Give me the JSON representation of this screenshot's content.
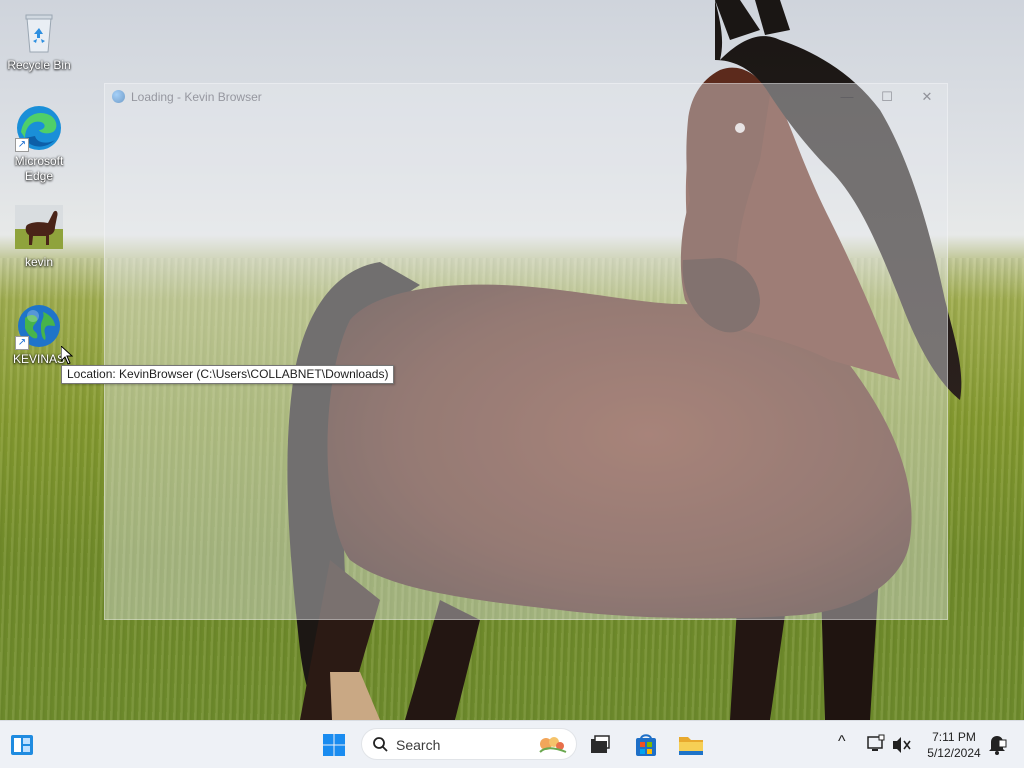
{
  "desktop": {
    "icons": [
      {
        "label": "Recycle Bin"
      },
      {
        "label": "Microsoft Edge"
      },
      {
        "label": "kevin"
      },
      {
        "label": "KEVINAS"
      }
    ]
  },
  "window": {
    "title": "Loading - Kevin Browser",
    "controls": {
      "minimize": "—",
      "maximize": "☐",
      "close": "✕"
    }
  },
  "tooltip": {
    "text": "Location: KevinBrowser (C:\\Users\\COLLABNET\\Downloads)"
  },
  "taskbar": {
    "search_label": "Search",
    "clock_time": "7:11 PM",
    "clock_date": "5/12/2024",
    "tray": {
      "overflow": "^"
    }
  },
  "colors": {
    "taskbar_bg": "#eef1f6",
    "windows_blue": "#0078d4",
    "tooltip_border": "#767676"
  }
}
